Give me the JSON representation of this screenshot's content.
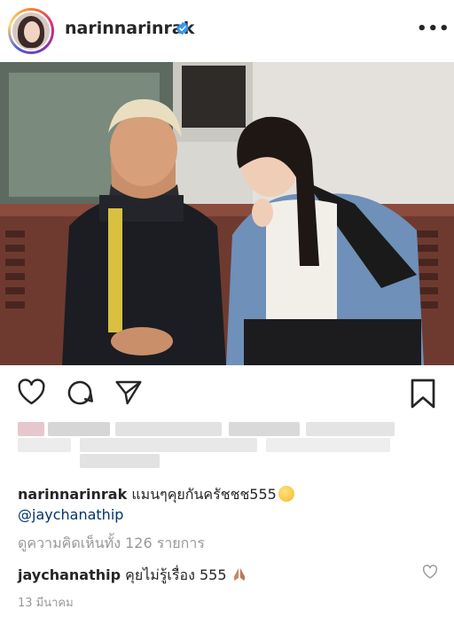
{
  "post": {
    "username": "narinnarinrak",
    "more_label": "•••",
    "caption_user": "narinnarinrak",
    "caption_text": "แมนๆคุยกันครัชชช555",
    "mention": "@jaychanathip",
    "view_all_comments": "ดูความคิดเห็นทั้ง 126 รายการ",
    "comment_user": "jaychanathip",
    "comment_text": "คุยไม่รู้เรื่อง 555",
    "timestamp": "13 มีนาคม"
  },
  "colors": {
    "text": "#262626",
    "secondary": "#999999",
    "verified": "#3897f0",
    "mention": "#003569"
  },
  "icons": [
    "verified-badge-icon",
    "heart-icon",
    "comment-icon",
    "share-icon",
    "bookmark-icon",
    "small-heart-icon"
  ]
}
